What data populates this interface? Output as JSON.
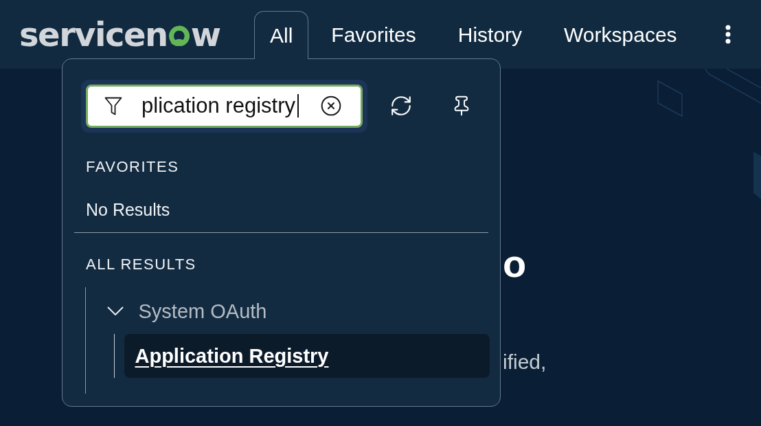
{
  "header": {
    "logo": {
      "text_start": "servicen",
      "text_end": "w"
    },
    "tabs": [
      {
        "label": "All",
        "selected": true
      },
      {
        "label": "Favorites",
        "selected": false
      },
      {
        "label": "History",
        "selected": false
      },
      {
        "label": "Workspaces",
        "selected": false
      }
    ]
  },
  "menu_panel": {
    "search": {
      "value": "plication registry",
      "focused": true
    },
    "favorites": {
      "heading": "FAVORITES",
      "empty_text": "No Results"
    },
    "all_results": {
      "heading": "ALL RESULTS",
      "groups": [
        {
          "label": "System OAuth",
          "expanded": true,
          "children": [
            {
              "label": "Application Registry",
              "selected": true
            }
          ]
        }
      ]
    }
  },
  "background": {
    "heading_fragment": "o",
    "text_fragment": "ified,"
  }
}
